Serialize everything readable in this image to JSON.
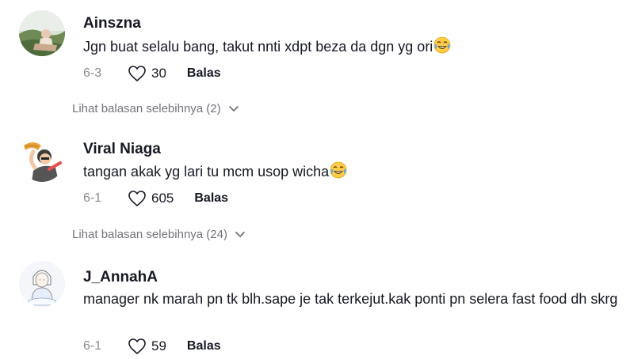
{
  "comments": [
    {
      "username": "Ainszna",
      "text": "Jgn buat selalu bang, takut nnti xdpt beza da dgn yg ori",
      "emoji": "laughing-tears",
      "date": "6-3",
      "likes": "30",
      "reply_label": "Balas",
      "more_replies": "Lihat balasan selebihnya (2)"
    },
    {
      "username": "Viral Niaga",
      "text": "tangan akak yg lari tu mcm usop wicha",
      "emoji": "laughing-tears",
      "date": "6-1",
      "likes": "605",
      "reply_label": "Balas",
      "more_replies": "Lihat balasan selebihnya (24)"
    },
    {
      "username": "J_AnnahA",
      "text": "manager nk marah pn tk blh.sape je tak terkejut.kak ponti pn selera fast food dh skrg",
      "date": "6-1",
      "likes": "59",
      "reply_label": "Balas"
    }
  ],
  "colors": {
    "text_primary": "#161823",
    "text_secondary": "#8a8b91",
    "link_grey": "#73747b"
  }
}
